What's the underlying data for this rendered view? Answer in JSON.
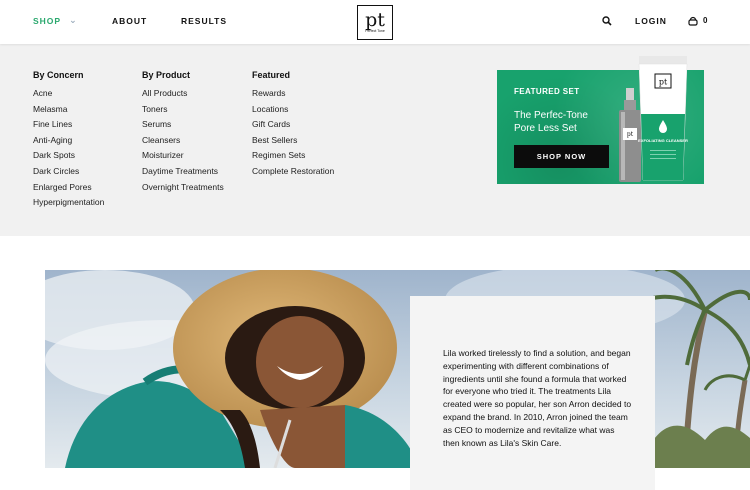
{
  "colors": {
    "accent": "#2aa86e",
    "promo_bg": "#18a26d",
    "menu_bg": "#f1f1f1",
    "button_dark": "#0c0c0c"
  },
  "header": {
    "nav": {
      "shop": "SHOP",
      "about": "ABOUT",
      "results": "RESULTS",
      "login": "LOGIN"
    },
    "logo": {
      "mark": "pt",
      "sub": "Perfect Tone"
    },
    "icons": {
      "search": "search-icon",
      "bag": "shopping-bag-icon",
      "dropdown": "chevron-down-icon"
    },
    "cart_count": "0"
  },
  "mega_menu": {
    "by_concern": {
      "title": "By Concern",
      "items": [
        "Acne",
        "Melasma",
        "Fine Lines",
        "Anti-Aging",
        "Dark Spots",
        "Dark Circles",
        "Enlarged Pores",
        "Hyperpigmentation"
      ]
    },
    "by_product": {
      "title": "By Product",
      "items": [
        "All Products",
        "Toners",
        "Serums",
        "Cleansers",
        "Moisturizer",
        "Daytime Treatments",
        "Overnight Treatments"
      ]
    },
    "featured": {
      "title": "Featured",
      "items": [
        "Rewards",
        "Locations",
        "Gift Cards",
        "Best Sellers",
        "Regimen Sets",
        "Complete Restoration"
      ]
    },
    "promo": {
      "kicker": "FEATURED SET",
      "title": "The Perfec-Tone Pore Less Set",
      "button": "SHOP NOW",
      "tube_label": "EXFOLIATING CLEANSER"
    }
  },
  "story": {
    "text": "Lila worked tirelessly to find a solution, and began experimenting with different combinations of ingredients until she found a formula that worked for everyone who tried it. The treatments Lila created were so popular, her son Arron decided to expand the brand. In 2010, Arron joined the team as CEO to modernize and revitalize what was then known as Lila's Skin Care."
  }
}
